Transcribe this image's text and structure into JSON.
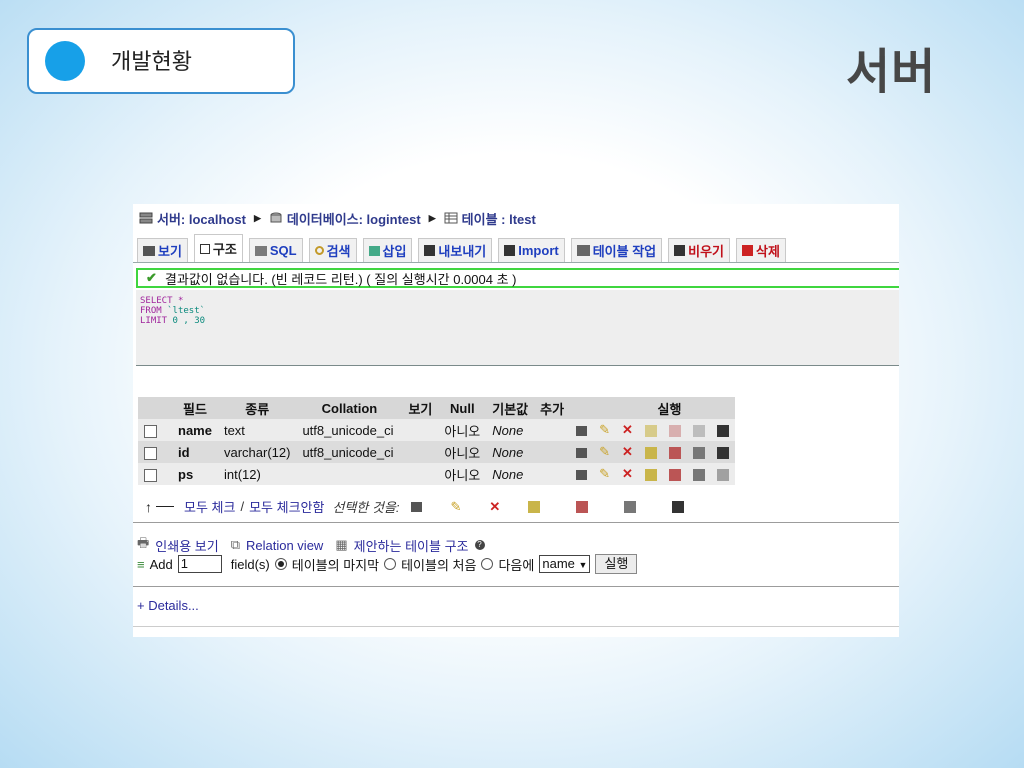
{
  "slide": {
    "section_label": "개발현황",
    "title": "서버"
  },
  "breadcrumb": {
    "server": "서버: localhost",
    "database": "데이터베이스: logintest",
    "table": "테이블 : ltest"
  },
  "tabs": [
    {
      "label": "보기"
    },
    {
      "label": "구조"
    },
    {
      "label": "SQL"
    },
    {
      "label": "검색"
    },
    {
      "label": "삽입"
    },
    {
      "label": "내보내기"
    },
    {
      "label": "Import"
    },
    {
      "label": "테이블 작업"
    },
    {
      "label": "비우기"
    },
    {
      "label": "삭제"
    }
  ],
  "notice": "결과값이 없습니다. (빈 레코드 리턴.) ( 질의 실행시간 0.0004 초 )",
  "sql": {
    "select": "SELECT",
    "star": "*",
    "from": "FROM",
    "table": "`ltest`",
    "limit": "LIMIT",
    "limit_val": "0 , 30"
  },
  "fields_table": {
    "headers": [
      "필드",
      "종류",
      "Collation",
      "보기",
      "Null",
      "기본값",
      "추가",
      "실행"
    ],
    "rows": [
      {
        "name": "name",
        "type": "text",
        "collation": "utf8_unicode_ci",
        "attributes": "",
        "null": "아니오",
        "default": "None",
        "extra": ""
      },
      {
        "name": "id",
        "type": "varchar(12)",
        "collation": "utf8_unicode_ci",
        "attributes": "",
        "null": "아니오",
        "default": "None",
        "extra": ""
      },
      {
        "name": "ps",
        "type": "int(12)",
        "collation": "",
        "attributes": "",
        "null": "아니오",
        "default": "None",
        "extra": ""
      }
    ]
  },
  "bulk": {
    "check_all": "모두 체크",
    "sep": "/",
    "uncheck_all": "모두 체크안함",
    "with_selected": "선택한 것을:"
  },
  "links": {
    "print_view": "인쇄용 보기",
    "relation_view": "Relation view",
    "propose": "제안하는 테이블 구조"
  },
  "add": {
    "label": "Add",
    "count": "1",
    "fields_label": "field(s)",
    "opt_end": "테이블의 마지막",
    "opt_start": "테이블의 처음",
    "opt_after": "다음에",
    "after_col": "name",
    "go": "실행"
  },
  "details": "+ Details..."
}
